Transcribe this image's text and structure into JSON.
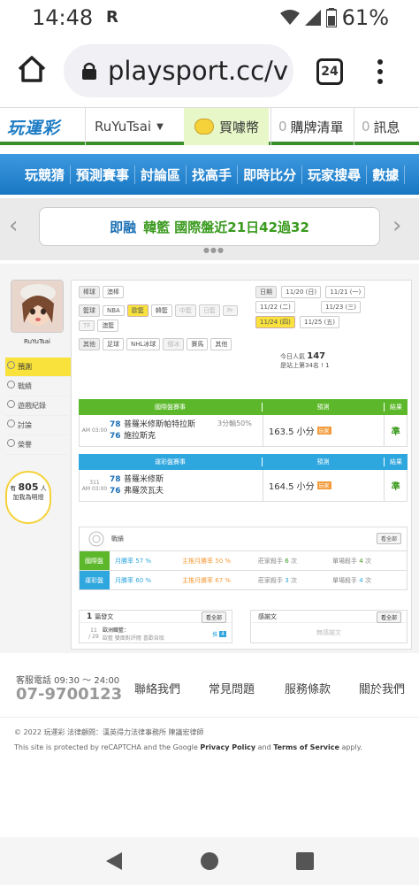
{
  "status": {
    "time": "14:48",
    "carrier": "R",
    "battery": "61%"
  },
  "browser": {
    "url": "playsport.cc/v",
    "tabs": "24"
  },
  "site": {
    "logo": "玩運彩",
    "user": "RuYuTsai",
    "coin": "買噱幣",
    "cart_count": "0",
    "cart": "購牌清單",
    "msg_count": "0",
    "msg": "訊息"
  },
  "nav": [
    "玩競猜",
    "預測賽事",
    "討論區",
    "找高手",
    "即時比分",
    "玩家搜尋",
    "數據"
  ],
  "banner": {
    "lead": "即融",
    "text": "韓籃 國際盤近21日42過32"
  },
  "sidebar": {
    "name": "RuYuTsai",
    "items": [
      "預測",
      "戰績",
      "遊戲紀錄",
      "討論",
      "榮譽"
    ],
    "bubble_pre": "有",
    "bubble_num": "805",
    "bubble_unit": "人",
    "bubble_post": "加我為明燈"
  },
  "filters": {
    "row1_label": "棒球",
    "row1": [
      "澳棒"
    ],
    "row2_label": "籃球",
    "row2": [
      "NBA",
      "歐籃",
      "韓籃",
      "中籃",
      "日籃",
      "Pr",
      "TF",
      "澳籃"
    ],
    "row3_label": "其他",
    "row3": [
      "足球",
      "NHL冰球",
      "俄冰",
      "賽馬",
      "其他"
    ]
  },
  "dates": {
    "label": "日期",
    "items": [
      "11/20 (日)",
      "11/21 (一)",
      "11/22 (二)",
      "11/23 (三)",
      "11/24 (四)",
      "11/25 (五)"
    ],
    "active": "11/24 (四)"
  },
  "popularity": {
    "label": "今日人氣",
    "value": "147",
    "rank": "是站上第34名 ! 1"
  },
  "table1": {
    "head": [
      "國際盤賽事",
      "預測",
      "結果"
    ],
    "time": "AM 03:00",
    "num1": "78",
    "team1": "普羅米修斯帕特拉斯",
    "num2": "76",
    "team2": "施拉斯克",
    "note": "3分輸50%",
    "pick": "163.5 小分",
    "pick_badge": "玩家",
    "result": "準"
  },
  "table2": {
    "head": [
      "運彩盤賽事",
      "預測",
      "結果"
    ],
    "code": "311",
    "time": "AM 03:00",
    "num1": "78",
    "team1": "普羅米修斯",
    "num2": "76",
    "team2": "弗羅茨瓦夫",
    "pick": "164.5 小分",
    "pick_badge": "玩家",
    "result": "準"
  },
  "record": {
    "title": "戰績",
    "view_all": "看全部",
    "row1": {
      "label": "國際盤",
      "a": "月勝率",
      "av": "57",
      "b": "主推月勝率",
      "bv": "50",
      "c": "莊家殺手",
      "cv": "6",
      "d": "單場殺手",
      "dv": "4"
    },
    "row2": {
      "label": "運彩盤",
      "a": "月勝率",
      "av": "60",
      "b": "主推月勝率",
      "bv": "67",
      "c": "莊家殺手",
      "cv": "3",
      "d": "單場殺手",
      "dv": "4"
    },
    "pct": "%",
    "times": "次"
  },
  "posts": {
    "count": "1",
    "title": "篇發文",
    "view_all": "看全部",
    "num": "11",
    "date": "/ 29",
    "subj": "歐洲職籃：",
    "preview": "歐籃 雙面對評閱 喜歡自取",
    "push": "推",
    "push_n": "4"
  },
  "replies": {
    "title": "感謝文",
    "view_all": "看全部",
    "empty": "無感謝文"
  },
  "footer": {
    "phone_label": "客服電話 09:30 ～ 24:00",
    "phone": "07-9700123",
    "links": [
      "聯絡我們",
      "常見問題",
      "服務條款",
      "關於我們"
    ],
    "copyright": "© 2022 玩運彩 法律顧問：漢英得力法律事務所 陳議宏律師",
    "cap_pre": "This site is protected by reCAPTCHA and the Google ",
    "cap_pp": "Privacy Policy",
    "cap_and": " and ",
    "cap_tos": "Terms of Service",
    "cap_post": " apply."
  }
}
